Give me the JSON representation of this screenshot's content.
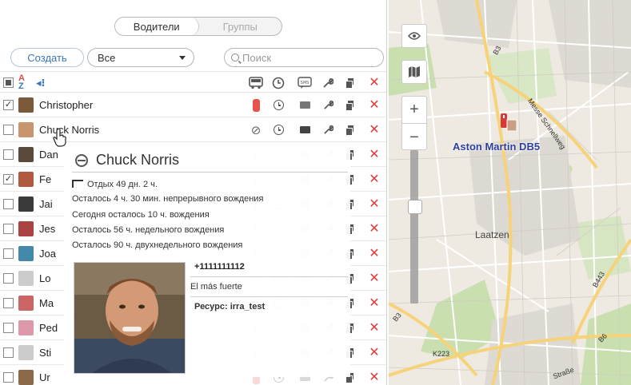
{
  "tabs": {
    "drivers": "Водители",
    "groups": "Группы"
  },
  "toolbar": {
    "create": "Создать",
    "filter_value": "Все",
    "search_placeholder": "Поиск"
  },
  "header": {
    "sort_label_top": "A",
    "sort_label_bottom": "Z",
    "group_icon": "group-icon"
  },
  "drivers": [
    {
      "name": "Christopher",
      "checked": true
    },
    {
      "name": "Chuck Norris",
      "checked": false
    },
    {
      "name": "Dan",
      "checked": false
    },
    {
      "name": "Fe",
      "checked": true
    },
    {
      "name": "Jai",
      "checked": false
    },
    {
      "name": "Jes",
      "checked": false
    },
    {
      "name": "Joa",
      "checked": false
    },
    {
      "name": "Lo",
      "checked": false
    },
    {
      "name": "Ma",
      "checked": false
    },
    {
      "name": "Ped",
      "checked": false
    },
    {
      "name": "Sti",
      "checked": false
    },
    {
      "name": "Ur",
      "checked": false
    }
  ],
  "popup": {
    "name": "Chuck Norris",
    "rest": "Отдых 49 дн. 2 ч.",
    "stat1": "Осталось 4 ч. 30 мин. непрерывного вождения",
    "stat2": "Сегодня осталось 10 ч. вождения",
    "stat3": "Осталось 56 ч. недельного вождения",
    "stat4": "Осталось 90 ч. двухнедельного вождения",
    "phone": "+1111111112",
    "motto": "El más fuerte",
    "resource_label": "Ресурс:",
    "resource_value": "irra_test"
  },
  "map": {
    "unit_label": "Aston Martin DB5",
    "city_label": "Laatzen",
    "roads": [
      "B3",
      "B443",
      "B6",
      "K223",
      "B3",
      "Messe Schnellweg",
      "Straße"
    ],
    "zoom_in": "+",
    "zoom_out": "−"
  },
  "colors": {
    "accent": "#3a78b8",
    "delete": "#e03a3a",
    "unit_label": "#2c3d9e"
  }
}
